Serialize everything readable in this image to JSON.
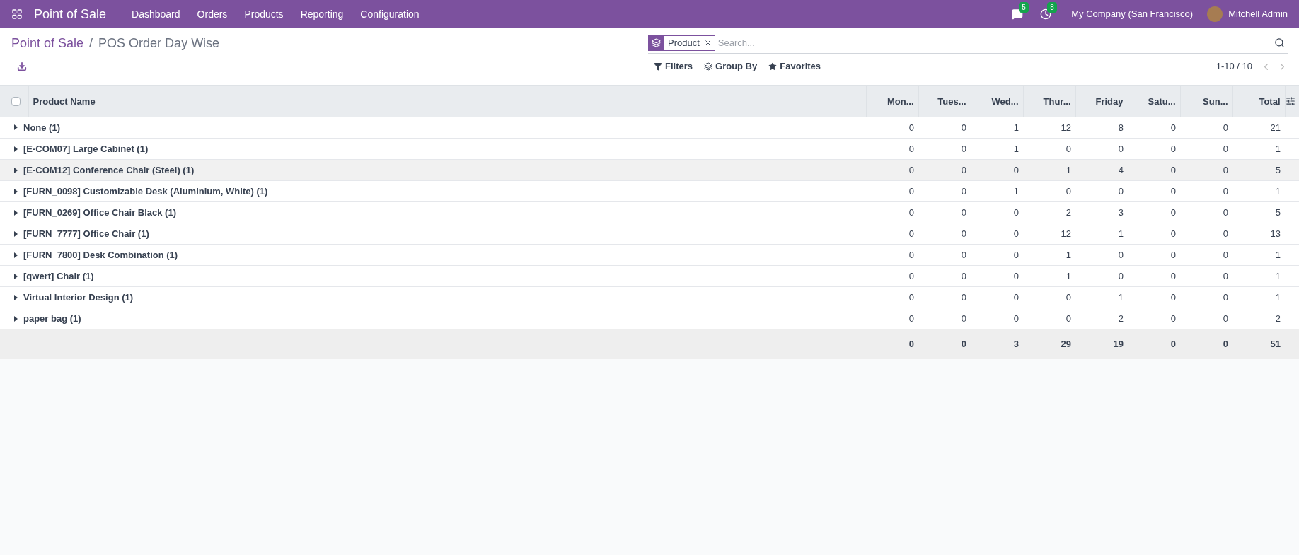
{
  "navbar": {
    "app_name": "Point of Sale",
    "menu": [
      "Dashboard",
      "Orders",
      "Products",
      "Reporting",
      "Configuration"
    ],
    "messages_count": "5",
    "activities_count": "8",
    "company": "My Company (San Francisco)",
    "user": "Mitchell Admin"
  },
  "breadcrumb": {
    "parent": "Point of Sale",
    "separator": "/",
    "current": "POS Order Day Wise"
  },
  "search": {
    "facet": "Product",
    "placeholder": "Search..."
  },
  "toolbar": {
    "filters": "Filters",
    "group_by": "Group By",
    "favorites": "Favorites",
    "pager": "1-10 / 10"
  },
  "table": {
    "select_all_checked": false,
    "columns": [
      "Product Name",
      "Mon...",
      "Tues...",
      "Wed...",
      "Thur...",
      "Friday",
      "Satu...",
      "Sun...",
      "Total"
    ],
    "rows": [
      {
        "name": "None (1)",
        "selected": false,
        "values": [
          "0",
          "0",
          "1",
          "12",
          "8",
          "0",
          "0",
          "21"
        ]
      },
      {
        "name": "[E-COM07] Large Cabinet (1)",
        "selected": false,
        "values": [
          "0",
          "0",
          "1",
          "0",
          "0",
          "0",
          "0",
          "1"
        ]
      },
      {
        "name": "[E-COM12] Conference Chair (Steel) (1)",
        "selected": true,
        "values": [
          "0",
          "0",
          "0",
          "1",
          "4",
          "0",
          "0",
          "5"
        ]
      },
      {
        "name": "[FURN_0098] Customizable Desk (Aluminium, White) (1)",
        "selected": false,
        "values": [
          "0",
          "0",
          "1",
          "0",
          "0",
          "0",
          "0",
          "1"
        ]
      },
      {
        "name": "[FURN_0269] Office Chair Black (1)",
        "selected": false,
        "values": [
          "0",
          "0",
          "0",
          "2",
          "3",
          "0",
          "0",
          "5"
        ]
      },
      {
        "name": "[FURN_7777] Office Chair (1)",
        "selected": false,
        "values": [
          "0",
          "0",
          "0",
          "12",
          "1",
          "0",
          "0",
          "13"
        ]
      },
      {
        "name": "[FURN_7800] Desk Combination (1)",
        "selected": false,
        "values": [
          "0",
          "0",
          "0",
          "1",
          "0",
          "0",
          "0",
          "1"
        ]
      },
      {
        "name": "[qwert] Chair (1)",
        "selected": false,
        "values": [
          "0",
          "0",
          "0",
          "1",
          "0",
          "0",
          "0",
          "1"
        ]
      },
      {
        "name": "Virtual Interior Design (1)",
        "selected": false,
        "values": [
          "0",
          "0",
          "0",
          "0",
          "1",
          "0",
          "0",
          "1"
        ]
      },
      {
        "name": "paper bag (1)",
        "selected": false,
        "values": [
          "0",
          "0",
          "0",
          "0",
          "2",
          "0",
          "0",
          "2"
        ]
      }
    ],
    "totals": [
      "0",
      "0",
      "3",
      "29",
      "19",
      "0",
      "0",
      "51"
    ]
  }
}
